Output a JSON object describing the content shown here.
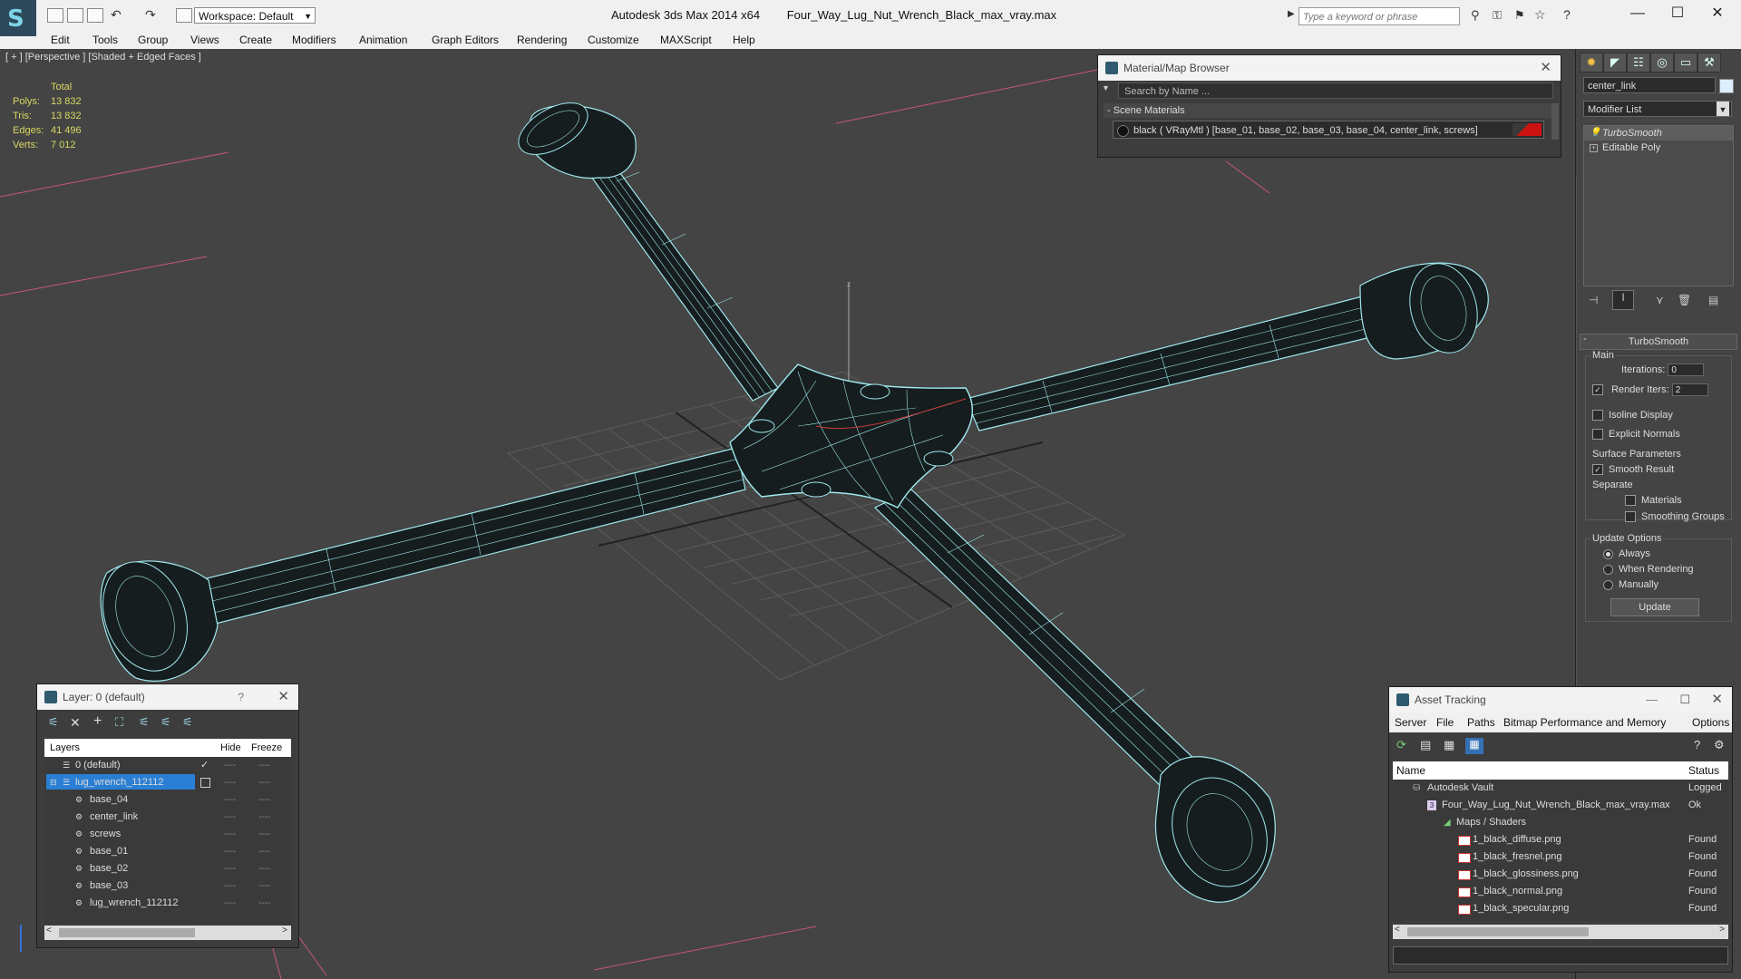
{
  "titlebar": {
    "app_title": "Autodesk 3ds Max  2014 x64",
    "file_title": "Four_Way_Lug_Nut_Wrench_Black_max_vray.max",
    "workspace": "Workspace: Default",
    "search_placeholder": "Type a keyword or phrase"
  },
  "menu": [
    "Edit",
    "Tools",
    "Group",
    "Views",
    "Create",
    "Modifiers",
    "Animation",
    "Graph Editors",
    "Rendering",
    "Customize",
    "MAXScript",
    "Help"
  ],
  "viewport": {
    "label": "[ + ] [Perspective ] [Shaded + Edged Faces ]",
    "stats": {
      "header": "Total",
      "rows": [
        {
          "k": "Polys:",
          "v": "13 832"
        },
        {
          "k": "Tris:",
          "v": "13 832"
        },
        {
          "k": "Edges:",
          "v": "41 496"
        },
        {
          "k": "Verts:",
          "v": "7 012"
        }
      ]
    },
    "axis_label": "z"
  },
  "material_browser": {
    "title": "Material/Map Browser",
    "search_placeholder": "Search by Name ...",
    "section": "- Scene Materials",
    "material_entry": "black  ( VRayMtl )  [base_01, base_02, base_03, base_04, center_link, screws]",
    "swatch_color": "#cc1111"
  },
  "command_panel": {
    "object_name": "center_link",
    "modifier_list": "Modifier List",
    "stack": [
      "TurboSmooth",
      "Editable Poly"
    ],
    "rollout_title": "TurboSmooth",
    "main_label": "Main",
    "iterations_label": "Iterations:",
    "iterations_value": "0",
    "render_iters_label": "Render Iters:",
    "render_iters_value": "2",
    "isoline": "Isoline Display",
    "explicit": "Explicit Normals",
    "surface_label": "Surface Parameters",
    "smooth_result": "Smooth Result",
    "separate_label": "Separate",
    "materials": "Materials",
    "smoothing_groups": "Smoothing Groups",
    "update_label": "Update Options",
    "always": "Always",
    "when_rendering": "When Rendering",
    "manually": "Manually",
    "update_button": "Update"
  },
  "layer_panel": {
    "title": "Layer: 0 (default)",
    "help": "?",
    "col_layers": "Layers",
    "col_hide": "Hide",
    "col_freeze": "Freeze",
    "rows": [
      "0 (default)",
      "lug_wrench_112112",
      "base_04",
      "center_link",
      "screws",
      "base_01",
      "base_02",
      "base_03",
      "lug_wrench_112112"
    ],
    "dash": "----"
  },
  "asset_panel": {
    "title": "Asset Tracking",
    "menu": [
      "Server",
      "File",
      "Paths",
      "Bitmap Performance and Memory",
      "Options"
    ],
    "col_name": "Name",
    "col_status": "Status",
    "rows": [
      {
        "name": "Autodesk Vault",
        "status": "Logged"
      },
      {
        "name": "Four_Way_Lug_Nut_Wrench_Black_max_vray.max",
        "status": "Ok"
      },
      {
        "name": "Maps / Shaders",
        "status": ""
      },
      {
        "name": "1_black_diffuse.png",
        "status": "Found"
      },
      {
        "name": "1_black_fresnel.png",
        "status": "Found"
      },
      {
        "name": "1_black_glossiness.png",
        "status": "Found"
      },
      {
        "name": "1_black_normal.png",
        "status": "Found"
      },
      {
        "name": "1_black_specular.png",
        "status": "Found"
      }
    ]
  },
  "colors": {
    "wire": "#9fe8ee",
    "selected_layer": "#2a7fd4",
    "stats": "#d8d865"
  }
}
